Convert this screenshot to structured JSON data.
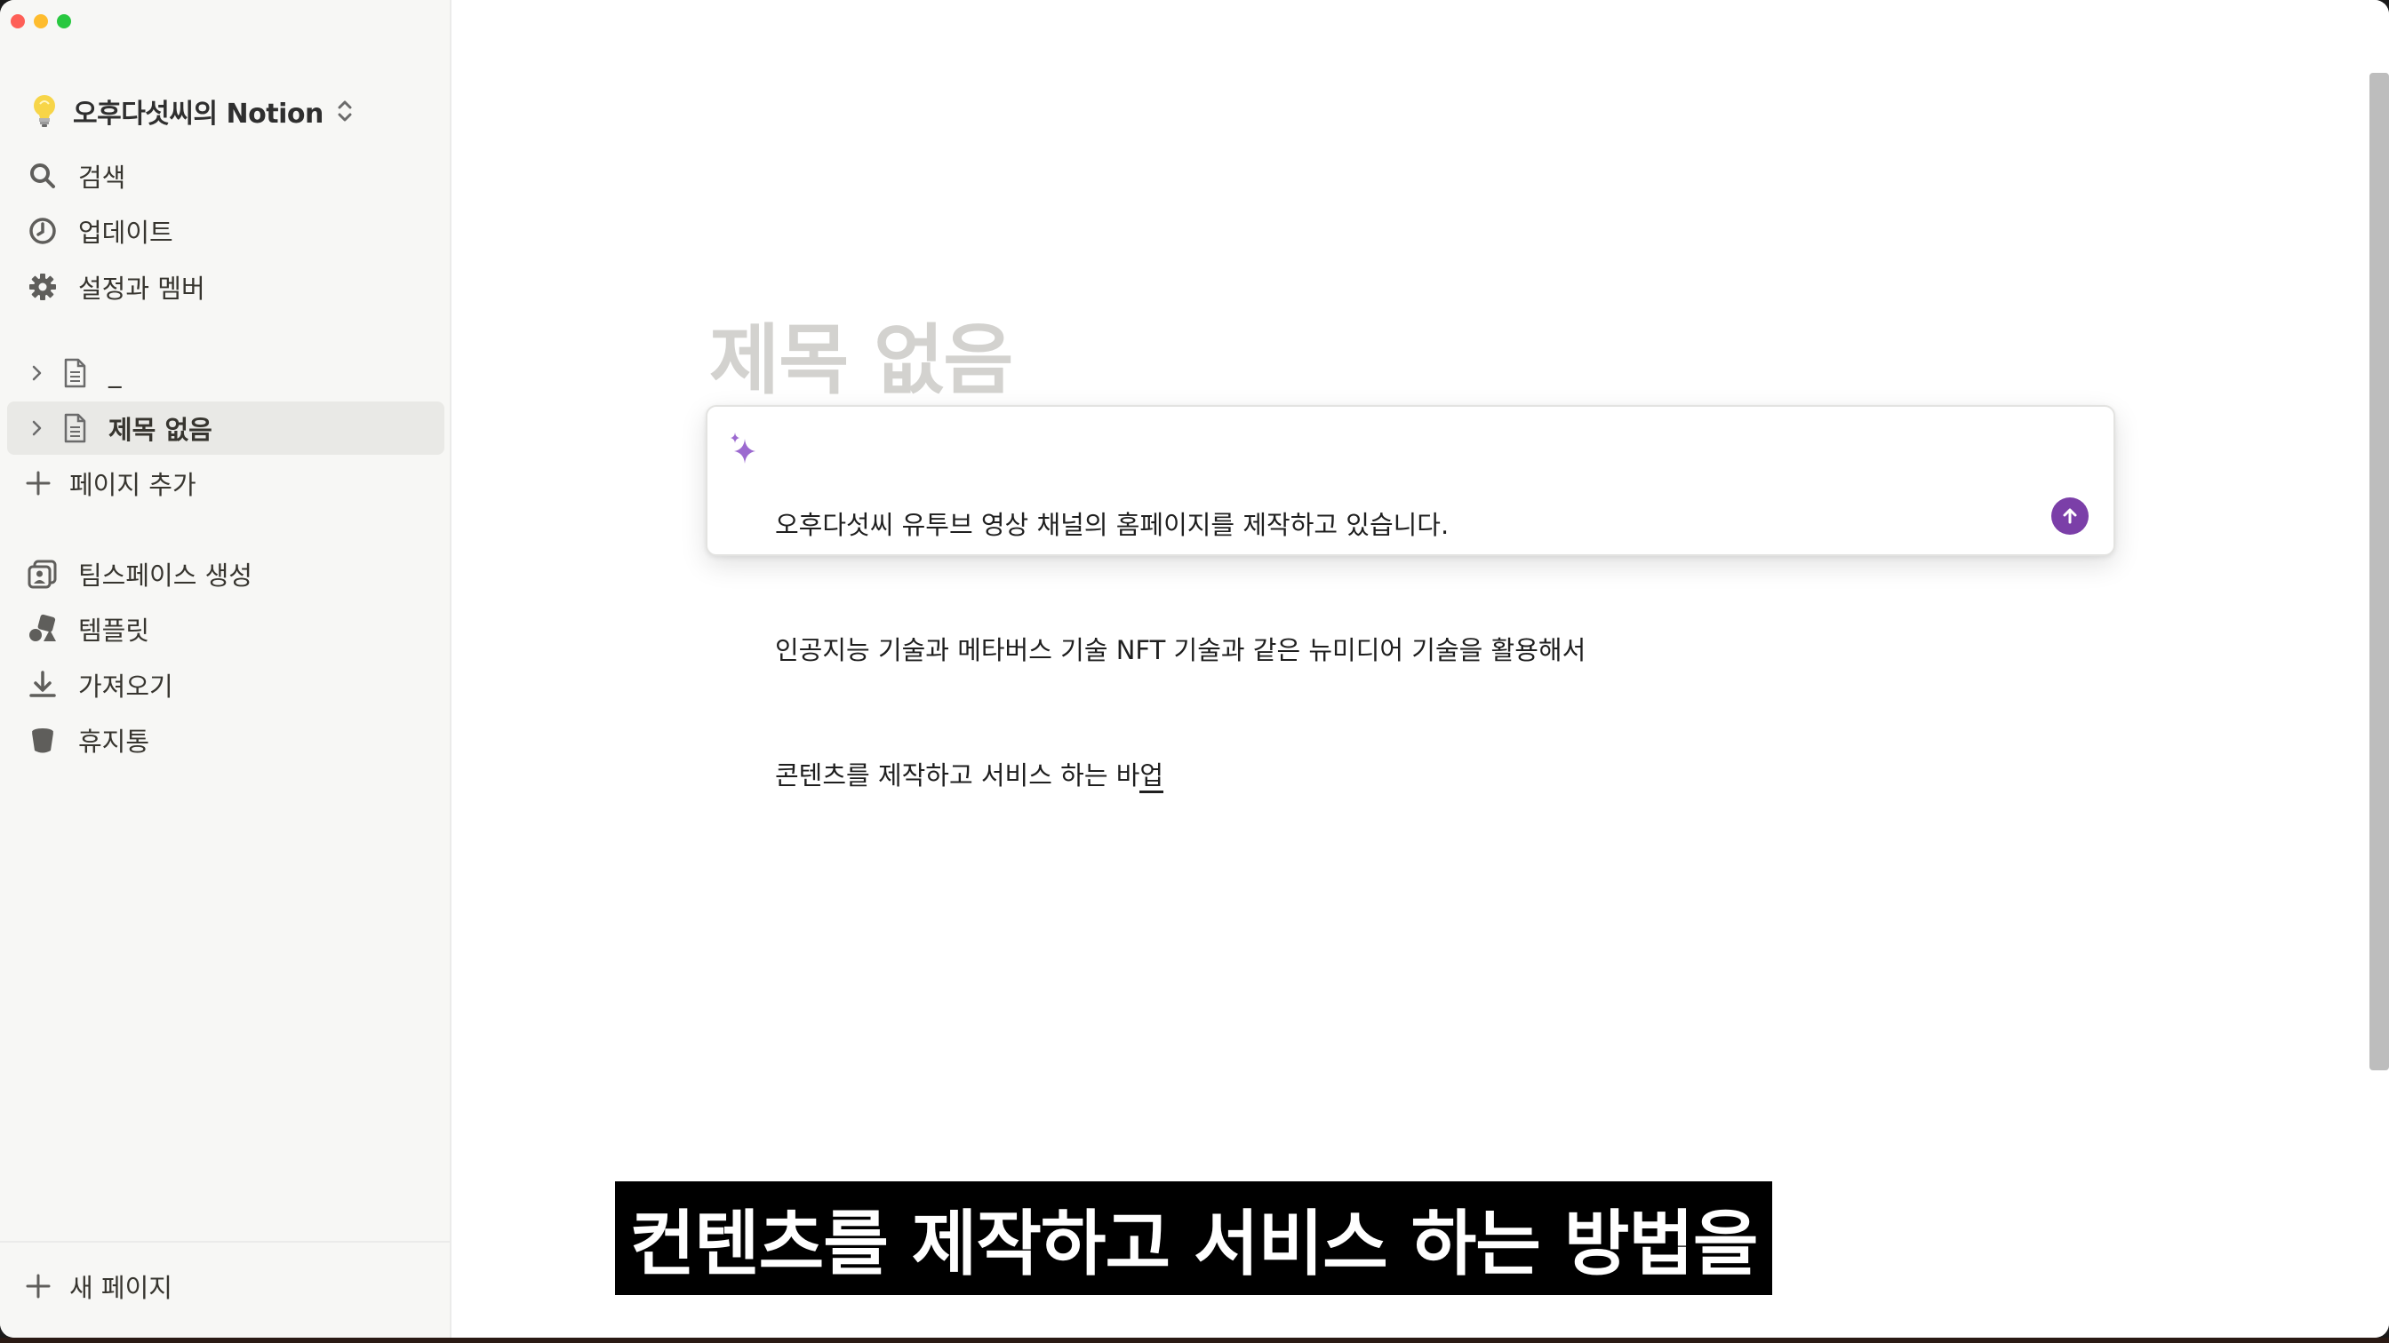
{
  "window": {
    "traffic_lights": [
      "close",
      "minimize",
      "zoom"
    ]
  },
  "sidebar": {
    "workspace": {
      "icon": "lightbulb-icon",
      "name": "오후다섯씨의 Notion"
    },
    "nav": [
      {
        "icon": "search-icon",
        "label": "검색"
      },
      {
        "icon": "clock-icon",
        "label": "업데이트"
      },
      {
        "icon": "gear-icon",
        "label": "설정과 멤버"
      }
    ],
    "pages": [
      {
        "icon": "document-icon",
        "label": "_",
        "active": false
      },
      {
        "icon": "document-icon",
        "label": "제목 없음",
        "active": true
      }
    ],
    "add_page": "페이지 추가",
    "secondary": [
      {
        "icon": "teamspace-icon",
        "label": "팀스페이스 생성"
      },
      {
        "icon": "template-icon",
        "label": "템플릿"
      },
      {
        "icon": "download-icon",
        "label": "가져오기"
      },
      {
        "icon": "trash-icon",
        "label": "휴지통"
      }
    ],
    "new_page": "새 페이지"
  },
  "main": {
    "title_placeholder": "제목 없음",
    "ai_prompt": {
      "lines": [
        "오후다섯씨 유투브 영상 채널의 홈페이지를 제작하고 있습니다.",
        "인공지능 기술과 메타버스 기술 NFT 기술과 같은 뉴미디어 기술을 활용해서",
        "콘텐츠를 제작하고 서비스 하는 바"
      ],
      "composing": "업",
      "accent": "#7b3fa8"
    }
  },
  "subtitle": "컨텐츠를 제작하고 서비스 하는 방법을"
}
